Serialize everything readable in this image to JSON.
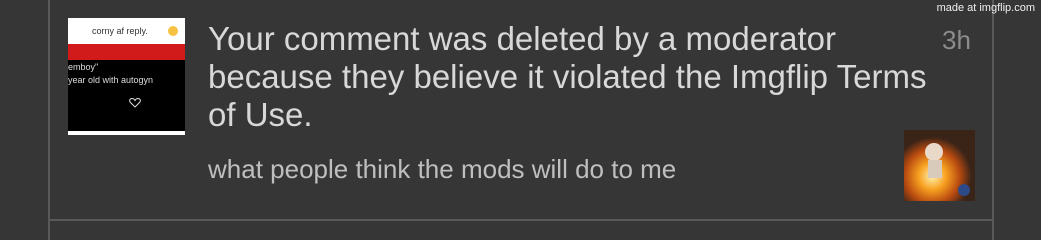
{
  "watermark": "made at imgflip.com",
  "thumbnail": {
    "top_text": "corny af reply.",
    "line1": "emboy\"",
    "line2": "year old with autogyn",
    "heart_icon": "heart-outline-icon"
  },
  "comment": {
    "text": "Your comment was deleted by a moderator because they believe it violated the Imgflip Terms of Use.",
    "time": "3h",
    "caption": "what people think the mods will do to me"
  },
  "colors": {
    "background": "#363636",
    "border": "#595959",
    "text": "#d8d8d8",
    "time": "#8c8c8c",
    "caption": "#bfbfbf"
  }
}
